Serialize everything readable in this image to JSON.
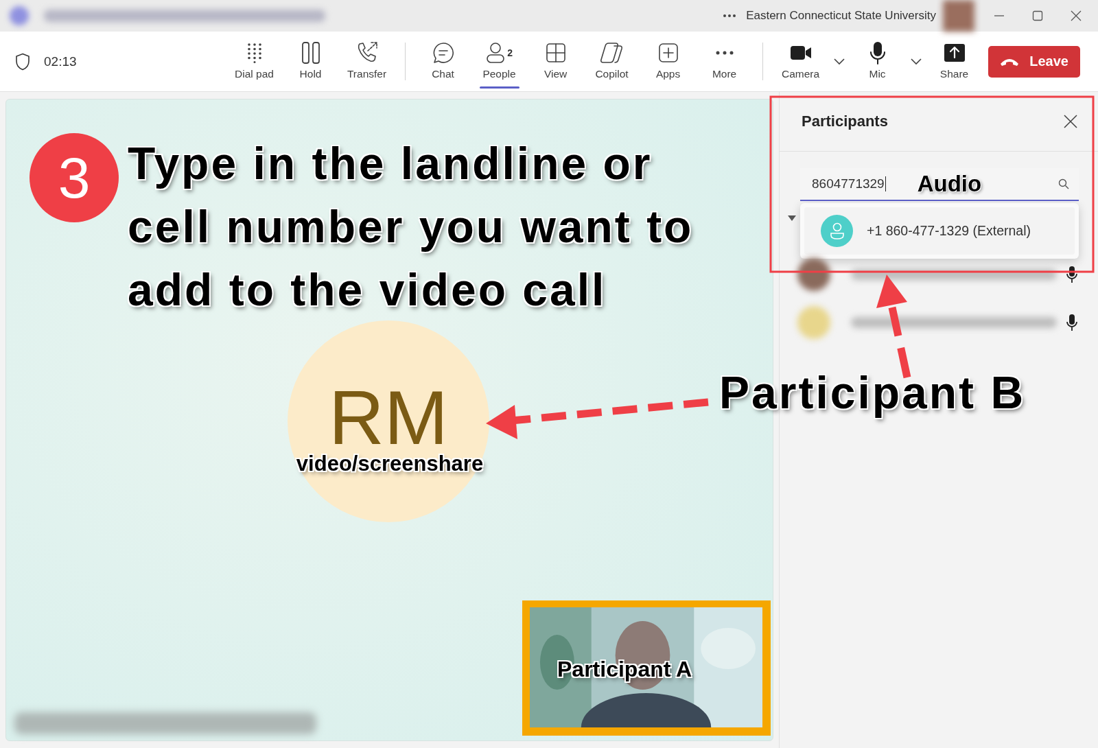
{
  "window": {
    "organization": "Eastern Connecticut State University"
  },
  "toolbar": {
    "timer": "02:13",
    "buttons": [
      {
        "label": "Dial pad",
        "kind": "call",
        "selected": false
      },
      {
        "label": "Hold",
        "kind": "call",
        "selected": false
      },
      {
        "label": "Transfer",
        "kind": "call",
        "selected": false
      },
      {
        "label": "Chat",
        "kind": "panel",
        "selected": false
      },
      {
        "label": "People",
        "kind": "panel",
        "selected": true,
        "badge": "2"
      },
      {
        "label": "View",
        "kind": "panel",
        "selected": false
      },
      {
        "label": "Copilot",
        "kind": "panel",
        "selected": false
      },
      {
        "label": "Apps",
        "kind": "panel",
        "selected": false
      },
      {
        "label": "More",
        "kind": "panel",
        "selected": false
      },
      {
        "label": "Camera",
        "kind": "media",
        "selected": false,
        "has_menu": true
      },
      {
        "label": "Mic",
        "kind": "media",
        "selected": false,
        "has_menu": true
      },
      {
        "label": "Share",
        "kind": "media",
        "selected": false
      }
    ],
    "leave_button": "Leave"
  },
  "stage": {
    "step_number": "3",
    "instruction": [
      "Type in the landline or",
      "cell number you want to",
      "add to the video call"
    ],
    "avatar_initials": "RM",
    "avatar_caption": "video/screenshare",
    "callout": "Participant B",
    "tile_label": "Participant A"
  },
  "participants_panel": {
    "title": "Participants",
    "search": {
      "value": "8604771329"
    },
    "search_annotation": "Audio",
    "suggestion": "+1 860-477-1329 (External)"
  }
}
